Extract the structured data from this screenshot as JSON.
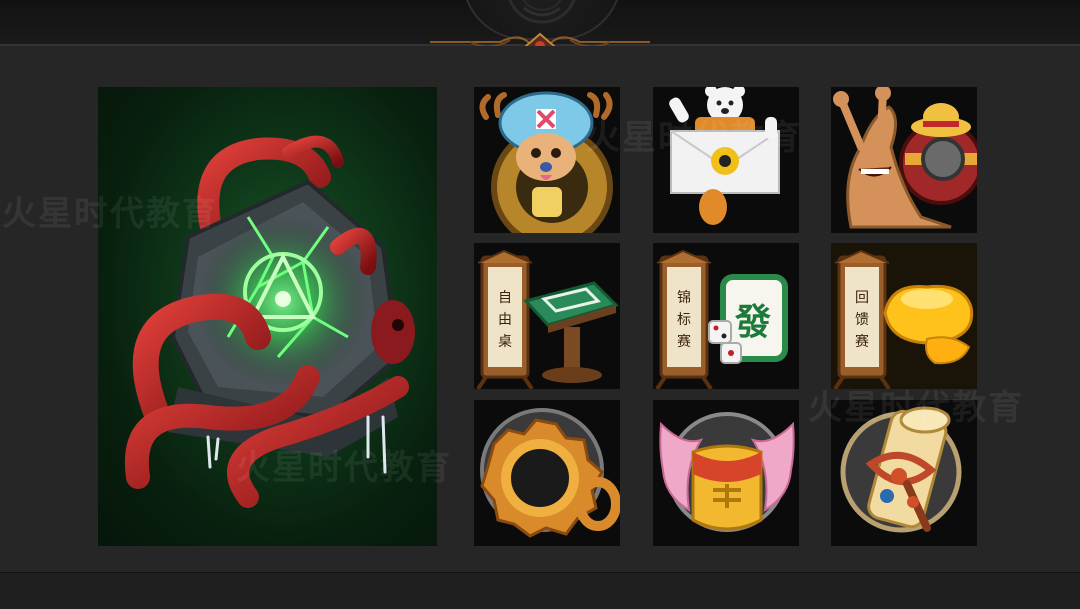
{
  "header": {
    "emblem": "ornate-crest-icon",
    "ornament": "gem-ornament-icon"
  },
  "hero": {
    "icon": "tentacle-rune-stone-icon",
    "glow_color": "#3cff6a",
    "tentacle_color": "#b51e1e"
  },
  "grid": {
    "tiles": [
      {
        "icon": "chopper-cog-icon"
      },
      {
        "icon": "bear-mail-icon"
      },
      {
        "icon": "snail-phone-icon"
      },
      {
        "icon": "sign-table-icon",
        "sign_text": "自由桌"
      },
      {
        "icon": "sign-mahjong-icon",
        "sign_text": "锦标赛",
        "tile_text": "發"
      },
      {
        "icon": "sign-gold-ingot-icon",
        "sign_text": "回馈赛"
      },
      {
        "icon": "gear-ring-icon"
      },
      {
        "icon": "winged-pouch-icon"
      },
      {
        "icon": "scroll-tassel-icon"
      }
    ]
  },
  "watermark": {
    "text": "火星时代教育"
  }
}
